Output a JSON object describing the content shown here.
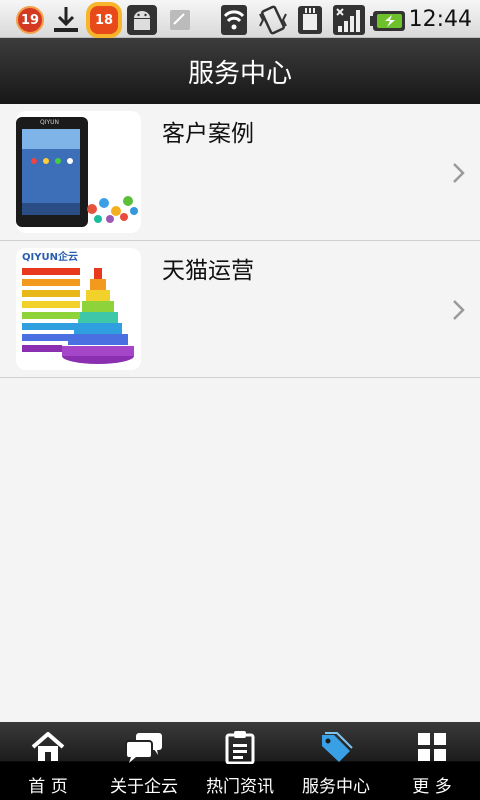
{
  "status_bar": {
    "badge_left": "19",
    "badge_right": "18",
    "time": "12:44"
  },
  "header": {
    "title": "服务中心"
  },
  "list": {
    "items": [
      {
        "title": "客户案例"
      },
      {
        "title": "天猫运营",
        "thumb_brand": "QIYUN企云"
      }
    ]
  },
  "tabs": [
    {
      "label": "首 页",
      "icon": "home-icon"
    },
    {
      "label": "关于企云",
      "icon": "chat-bubbles-icon"
    },
    {
      "label": "热门资讯",
      "icon": "clipboard-icon"
    },
    {
      "label": "服务中心",
      "icon": "tag-icon",
      "active": true
    },
    {
      "label": "更 多",
      "icon": "grid-icon"
    }
  ],
  "colors": {
    "active_icon": "#3aa0e6",
    "tab_text": "#ffffff",
    "title_text": "#ffffff"
  }
}
